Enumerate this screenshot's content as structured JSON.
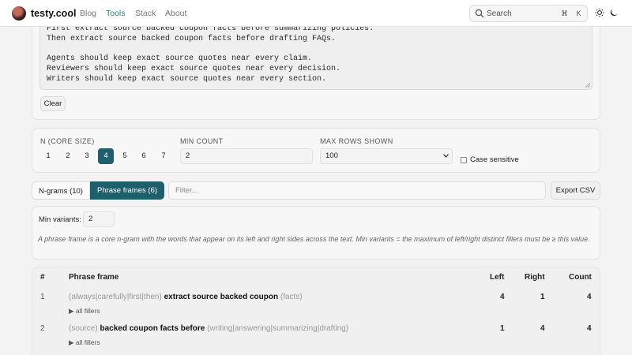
{
  "header": {
    "brand": "testy.cool",
    "nav": [
      "Blog",
      "Tools",
      "Stack",
      "About"
    ],
    "search_label": "Search",
    "kbd": [
      "⌘",
      "K"
    ]
  },
  "input": {
    "text": "First extract source backed coupon facts before summarizing policies.\nThen extract source backed coupon facts before drafting FAQs.\n\nAgents should keep exact source quotes near every claim.\nReviewers should keep exact source quotes near every decision.\nWriters should keep exact source quotes near every section.",
    "clear_label": "Clear"
  },
  "controls": {
    "n_label": "N (CORE SIZE)",
    "n_options": [
      "1",
      "2",
      "3",
      "4",
      "5",
      "6",
      "7"
    ],
    "n_selected": "4",
    "min_count_label": "MIN COUNT",
    "min_count_value": "2",
    "max_rows_label": "MAX ROWS SHOWN",
    "max_rows_value": "100",
    "case_label": "Case sensitive"
  },
  "tabs": {
    "ngrams": "N-grams (10)",
    "frames": "Phrase frames (6)",
    "filter_placeholder": "Filter...",
    "export": "Export CSV"
  },
  "frames_panel": {
    "min_variants_label": "Min variants:",
    "min_variants_value": "2",
    "note": "A phrase frame is a core n-gram with the words that appear on its left and right sides across the text. Min variants = the maximum of left/right distinct fillers must be ≥ this value."
  },
  "table": {
    "headers": {
      "idx": "#",
      "frame": "Phrase frame",
      "left": "Left",
      "right": "Right",
      "count": "Count"
    },
    "rows": [
      {
        "idx": "1",
        "left_fillers": "(always|carefully|first|then)",
        "core": "extract source backed coupon",
        "right_fillers": "(facts)",
        "left": "4",
        "right": "1",
        "count": "4",
        "details": "▶ all fillers"
      },
      {
        "idx": "2",
        "left_fillers": "(source)",
        "core": "backed coupon facts before",
        "right_fillers": "(writing|answering|summarizing|drafting)",
        "left": "1",
        "right": "4",
        "count": "4",
        "details": "▶ all fillers"
      }
    ]
  },
  "colors": {
    "accent": "#1f5f6b",
    "nav_active": "#208a7c"
  }
}
